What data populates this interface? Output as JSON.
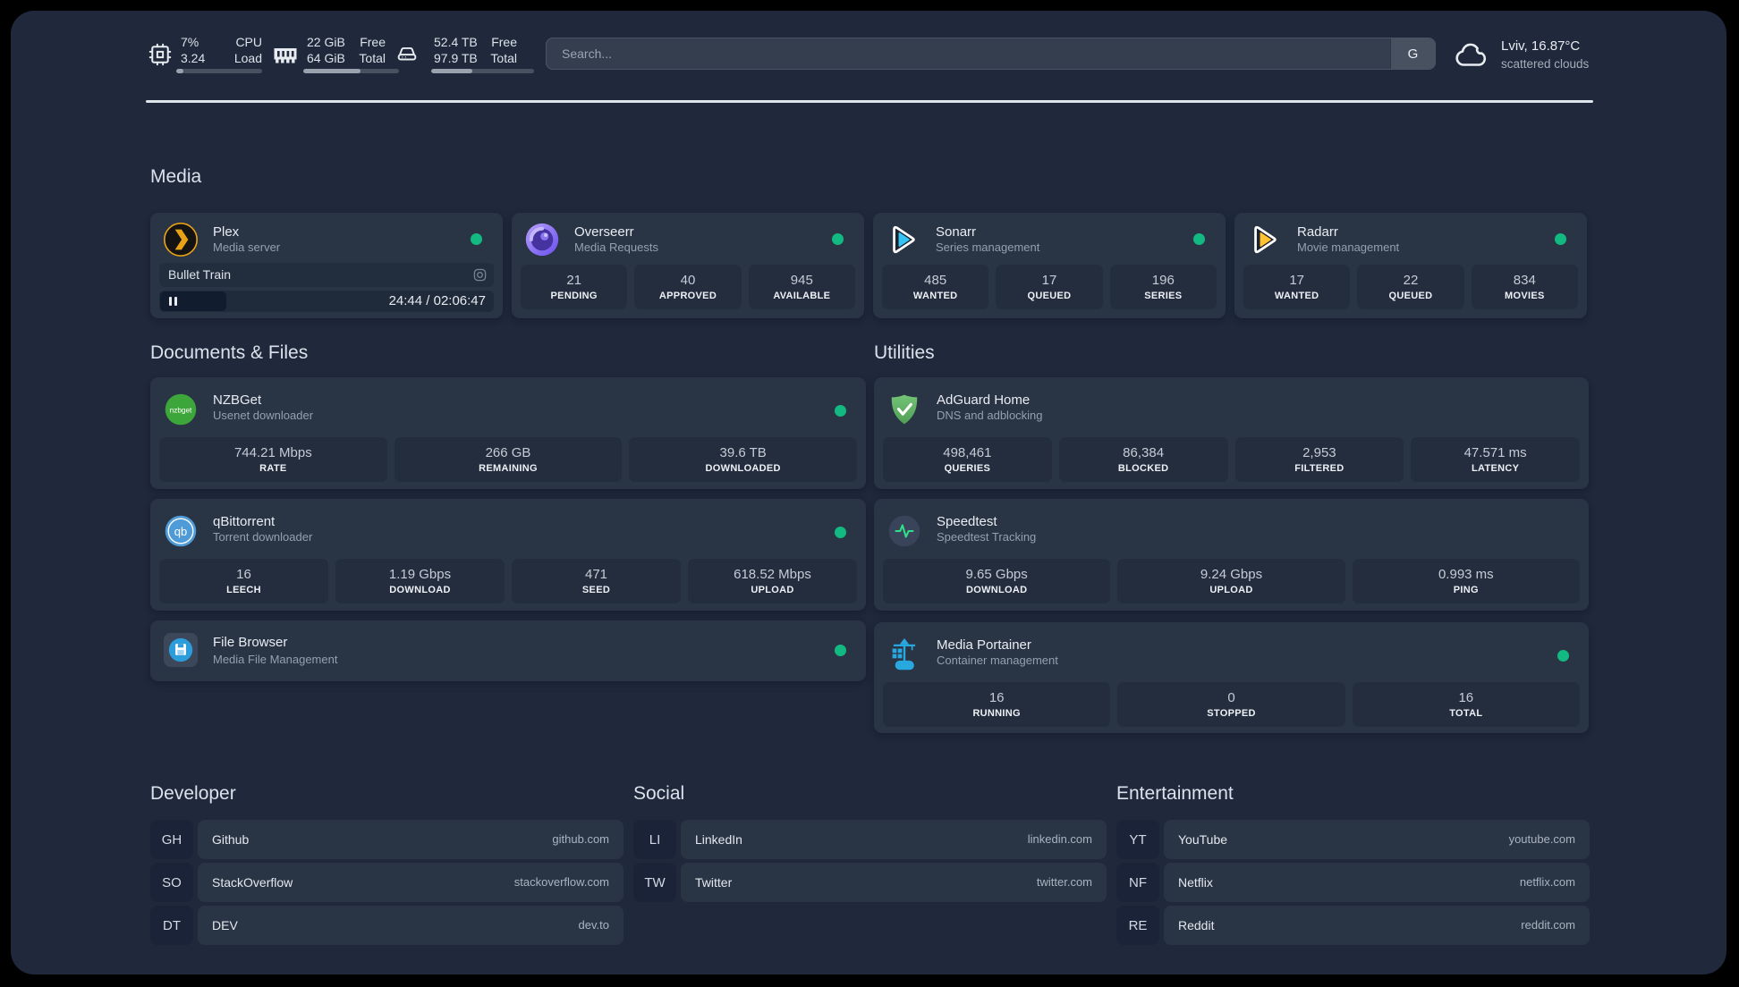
{
  "topbar": {
    "cpu": {
      "value1": "7%",
      "value2": "3.24",
      "label1": "CPU",
      "label2": "Load",
      "usage": "8%"
    },
    "memory": {
      "value1": "22 GiB",
      "value2": "64 GiB",
      "label1": "Free",
      "label2": "Total",
      "usage": "60%"
    },
    "disk": {
      "value1": "52.4 TB",
      "value2": "97.9 TB",
      "label1": "Free",
      "label2": "Total",
      "usage": "40%"
    },
    "search": {
      "placeholder": "Search...",
      "button": "G"
    },
    "weather": {
      "line1": "Lviv, 16.87°C",
      "line2": "scattered clouds"
    }
  },
  "sections": {
    "media": "Media",
    "documents": "Documents & Files",
    "utilities": "Utilities",
    "developer": "Developer",
    "social": "Social",
    "entertainment": "Entertainment"
  },
  "services": {
    "plex": {
      "name": "Plex",
      "desc": "Media server",
      "now_playing": "Bullet Train",
      "time": "24:44 / 02:06:47"
    },
    "overseerr": {
      "name": "Overseerr",
      "desc": "Media Requests",
      "stats": [
        {
          "value": "21",
          "label": "PENDING"
        },
        {
          "value": "40",
          "label": "APPROVED"
        },
        {
          "value": "945",
          "label": "AVAILABLE"
        }
      ]
    },
    "sonarr": {
      "name": "Sonarr",
      "desc": "Series management",
      "stats": [
        {
          "value": "485",
          "label": "WANTED"
        },
        {
          "value": "17",
          "label": "QUEUED"
        },
        {
          "value": "196",
          "label": "SERIES"
        }
      ]
    },
    "radarr": {
      "name": "Radarr",
      "desc": "Movie management",
      "stats": [
        {
          "value": "17",
          "label": "WANTED"
        },
        {
          "value": "22",
          "label": "QUEUED"
        },
        {
          "value": "834",
          "label": "MOVIES"
        }
      ]
    },
    "nzbget": {
      "name": "NZBGet",
      "desc": "Usenet downloader",
      "stats": [
        {
          "value": "744.21 Mbps",
          "label": "RATE"
        },
        {
          "value": "266 GB",
          "label": "REMAINING"
        },
        {
          "value": "39.6 TB",
          "label": "DOWNLOADED"
        }
      ]
    },
    "adguard": {
      "name": "AdGuard Home",
      "desc": "DNS and adblocking",
      "stats": [
        {
          "value": "498,461",
          "label": "QUERIES"
        },
        {
          "value": "86,384",
          "label": "BLOCKED"
        },
        {
          "value": "2,953",
          "label": "FILTERED"
        },
        {
          "value": "47.571 ms",
          "label": "LATENCY"
        }
      ]
    },
    "qbittorrent": {
      "name": "qBittorrent",
      "desc": "Torrent downloader",
      "stats": [
        {
          "value": "16",
          "label": "LEECH"
        },
        {
          "value": "1.19 Gbps",
          "label": "DOWNLOAD"
        },
        {
          "value": "471",
          "label": "SEED"
        },
        {
          "value": "618.52 Mbps",
          "label": "UPLOAD"
        }
      ]
    },
    "speedtest": {
      "name": "Speedtest",
      "desc": "Speedtest Tracking",
      "stats": [
        {
          "value": "9.65 Gbps",
          "label": "DOWNLOAD"
        },
        {
          "value": "9.24 Gbps",
          "label": "UPLOAD"
        },
        {
          "value": "0.993 ms",
          "label": "PING"
        }
      ]
    },
    "filebrowser": {
      "name": "File Browser",
      "desc": "Media File Management"
    },
    "portainer": {
      "name": "Media Portainer",
      "desc": "Container management",
      "stats": [
        {
          "value": "16",
          "label": "RUNNING"
        },
        {
          "value": "0",
          "label": "STOPPED"
        },
        {
          "value": "16",
          "label": "TOTAL"
        }
      ]
    }
  },
  "bookmarks": {
    "developer": [
      {
        "abbr": "GH",
        "name": "Github",
        "url": "github.com"
      },
      {
        "abbr": "SO",
        "name": "StackOverflow",
        "url": "stackoverflow.com"
      },
      {
        "abbr": "DT",
        "name": "DEV",
        "url": "dev.to"
      }
    ],
    "social": [
      {
        "abbr": "LI",
        "name": "LinkedIn",
        "url": "linkedin.com"
      },
      {
        "abbr": "TW",
        "name": "Twitter",
        "url": "twitter.com"
      }
    ],
    "entertainment": [
      {
        "abbr": "YT",
        "name": "YouTube",
        "url": "youtube.com"
      },
      {
        "abbr": "NF",
        "name": "Netflix",
        "url": "netflix.com"
      },
      {
        "abbr": "RE",
        "name": "Reddit",
        "url": "reddit.com"
      }
    ]
  },
  "colors": {
    "status_green": "#12ba81",
    "background": "#1f293b",
    "card": "#293444"
  }
}
